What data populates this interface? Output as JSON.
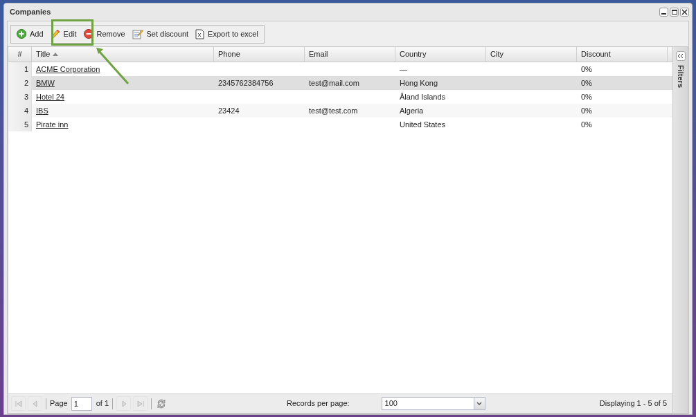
{
  "window": {
    "title": "Companies"
  },
  "toolbar": [
    {
      "kind": "add",
      "label": "Add",
      "highlighted": false
    },
    {
      "kind": "edit",
      "label": "Edit",
      "highlighted": true
    },
    {
      "kind": "remove",
      "label": "Remove",
      "highlighted": false
    },
    {
      "kind": "discount",
      "label": "Set discount",
      "highlighted": false
    },
    {
      "kind": "excel",
      "label": "Export to excel",
      "highlighted": false
    }
  ],
  "table": {
    "columns": [
      {
        "label": "#",
        "sorted": false
      },
      {
        "label": "Title",
        "sorted": true
      },
      {
        "label": "Phone",
        "sorted": false
      },
      {
        "label": "Email",
        "sorted": false
      },
      {
        "label": "Country",
        "sorted": false
      },
      {
        "label": "City",
        "sorted": false
      },
      {
        "label": "Discount",
        "sorted": false
      }
    ],
    "rows": [
      {
        "selected": false,
        "cells": [
          "1",
          "ACME Corporation",
          "",
          "",
          "—",
          "",
          "0%"
        ]
      },
      {
        "selected": true,
        "cells": [
          "2",
          "BMW",
          "2345762384756",
          "test@mail.com",
          "Hong Kong",
          "",
          "0%"
        ]
      },
      {
        "selected": false,
        "cells": [
          "3",
          "Hotel 24",
          "",
          "",
          "Åland Islands",
          "",
          "0%"
        ]
      },
      {
        "selected": false,
        "cells": [
          "4",
          "IBS",
          "23424",
          "test@test.com",
          "Algeria",
          "",
          "0%"
        ]
      },
      {
        "selected": false,
        "cells": [
          "5",
          "Pirate inn",
          "",
          "",
          "United States",
          "",
          "0%"
        ]
      }
    ]
  },
  "filters_panel": {
    "label": "Filters"
  },
  "pager": {
    "page_label": "Page",
    "page": "1",
    "of_label": "of 1",
    "records_label": "Records per page:",
    "records_value": "100",
    "display": "Displaying 1 - 5 of 5"
  }
}
